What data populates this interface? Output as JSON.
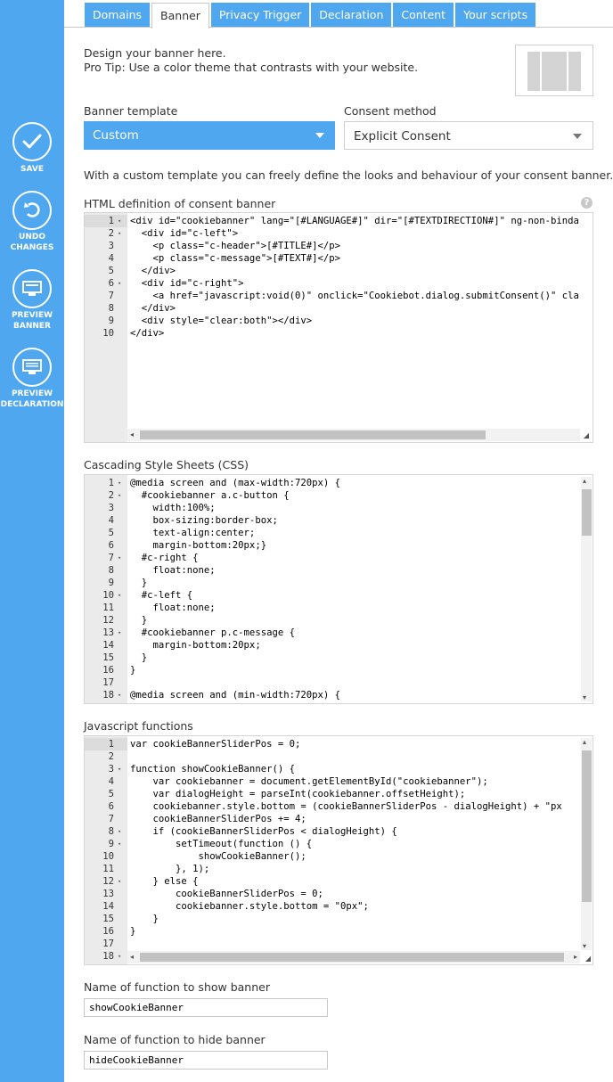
{
  "sidebar": {
    "items": [
      {
        "label1": "SAVE",
        "label2": ""
      },
      {
        "label1": "UNDO",
        "label2": "CHANGES"
      },
      {
        "label1": "PREVIEW",
        "label2": "BANNER"
      },
      {
        "label1": "PREVIEW",
        "label2": "DECLARATION"
      }
    ]
  },
  "tabs": [
    "Domains",
    "Banner",
    "Privacy Trigger",
    "Declaration",
    "Content",
    "Your scripts"
  ],
  "active_tab": "Banner",
  "intro": {
    "line1": "Design your banner here.",
    "line2": "Pro Tip: Use a color theme that contrasts with your website."
  },
  "banner_template": {
    "label": "Banner template",
    "value": "Custom",
    "accent": "#4fa7f0"
  },
  "consent_method": {
    "label": "Consent method",
    "value": "Explicit Consent"
  },
  "custom_note": "With a custom template you can freely define the looks and behaviour of your consent banner.",
  "html_editor": {
    "label": "HTML definition of consent banner",
    "help_icon": "?",
    "lines": [
      {
        "n": "1",
        "fold": "▾",
        "code": "<div id=\"cookiebanner\" lang=\"[#LANGUAGE#]\" dir=\"[#TEXTDIRECTION#]\" ng-non-binda"
      },
      {
        "n": "2",
        "fold": "▾",
        "code": "  <div id=\"c-left\">"
      },
      {
        "n": "3",
        "fold": "",
        "code": "    <p class=\"c-header\">[#TITLE#]</p>"
      },
      {
        "n": "4",
        "fold": "",
        "code": "    <p class=\"c-message\">[#TEXT#]</p>"
      },
      {
        "n": "5",
        "fold": "",
        "code": "  </div>"
      },
      {
        "n": "6",
        "fold": "▾",
        "code": "  <div id=\"c-right\">"
      },
      {
        "n": "7",
        "fold": "",
        "code": "    <a href=\"javascript:void(0)\" onclick=\"Cookiebot.dialog.submitConsent()\" cla"
      },
      {
        "n": "8",
        "fold": "",
        "code": "  </div>"
      },
      {
        "n": "9",
        "fold": "",
        "code": "  <div style=\"clear:both\"></div>"
      },
      {
        "n": "10",
        "fold": "",
        "code": "</div>"
      }
    ]
  },
  "css_editor": {
    "label": "Cascading Style Sheets (CSS)",
    "lines": [
      {
        "n": "1",
        "fold": "▾",
        "code": "@media screen and (max-width:720px) {"
      },
      {
        "n": "2",
        "fold": "▾",
        "code": "  #cookiebanner a.c-button {"
      },
      {
        "n": "3",
        "fold": "",
        "code": "    width:100%;"
      },
      {
        "n": "4",
        "fold": "",
        "code": "    box-sizing:border-box;"
      },
      {
        "n": "5",
        "fold": "",
        "code": "    text-align:center;"
      },
      {
        "n": "6",
        "fold": "",
        "code": "    margin-bottom:20px;}"
      },
      {
        "n": "7",
        "fold": "▾",
        "code": "  #c-right {"
      },
      {
        "n": "8",
        "fold": "",
        "code": "    float:none;"
      },
      {
        "n": "9",
        "fold": "",
        "code": "  }"
      },
      {
        "n": "10",
        "fold": "▾",
        "code": "  #c-left {"
      },
      {
        "n": "11",
        "fold": "",
        "code": "    float:none;"
      },
      {
        "n": "12",
        "fold": "",
        "code": "  }"
      },
      {
        "n": "13",
        "fold": "▾",
        "code": "  #cookiebanner p.c-message {"
      },
      {
        "n": "14",
        "fold": "",
        "code": "    margin-bottom:20px;"
      },
      {
        "n": "15",
        "fold": "",
        "code": "  }"
      },
      {
        "n": "16",
        "fold": "",
        "code": "}"
      },
      {
        "n": "17",
        "fold": "",
        "code": ""
      },
      {
        "n": "18",
        "fold": "▾",
        "code": "@media screen and (min-width:720px) {"
      }
    ]
  },
  "js_editor": {
    "label": "Javascript functions",
    "lines": [
      {
        "n": "1",
        "fold": "",
        "code": "var cookieBannerSliderPos = 0;"
      },
      {
        "n": "2",
        "fold": "",
        "code": ""
      },
      {
        "n": "3",
        "fold": "▾",
        "code": "function showCookieBanner() {"
      },
      {
        "n": "4",
        "fold": "",
        "code": "    var cookiebanner = document.getElementById(\"cookiebanner\");"
      },
      {
        "n": "5",
        "fold": "",
        "code": "    var dialogHeight = parseInt(cookiebanner.offsetHeight);"
      },
      {
        "n": "6",
        "fold": "",
        "code": "    cookiebanner.style.bottom = (cookieBannerSliderPos - dialogHeight) + \"px"
      },
      {
        "n": "7",
        "fold": "",
        "code": "    cookieBannerSliderPos += 4;"
      },
      {
        "n": "8",
        "fold": "▾",
        "code": "    if (cookieBannerSliderPos < dialogHeight) {"
      },
      {
        "n": "9",
        "fold": "▾",
        "code": "        setTimeout(function () {"
      },
      {
        "n": "10",
        "fold": "",
        "code": "            showCookieBanner();"
      },
      {
        "n": "11",
        "fold": "",
        "code": "        }, 1);"
      },
      {
        "n": "12",
        "fold": "▾",
        "code": "    } else {"
      },
      {
        "n": "13",
        "fold": "",
        "code": "        cookieBannerSliderPos = 0;"
      },
      {
        "n": "14",
        "fold": "",
        "code": "        cookiebanner.style.bottom = \"0px\";"
      },
      {
        "n": "15",
        "fold": "",
        "code": "    }"
      },
      {
        "n": "16",
        "fold": "",
        "code": "}"
      },
      {
        "n": "17",
        "fold": "",
        "code": ""
      },
      {
        "n": "18",
        "fold": "▾",
        "code": ""
      }
    ]
  },
  "show_fn": {
    "label": "Name of function to show banner",
    "value": "showCookieBanner"
  },
  "hide_fn": {
    "label": "Name of function to hide banner",
    "value": "hideCookieBanner"
  }
}
